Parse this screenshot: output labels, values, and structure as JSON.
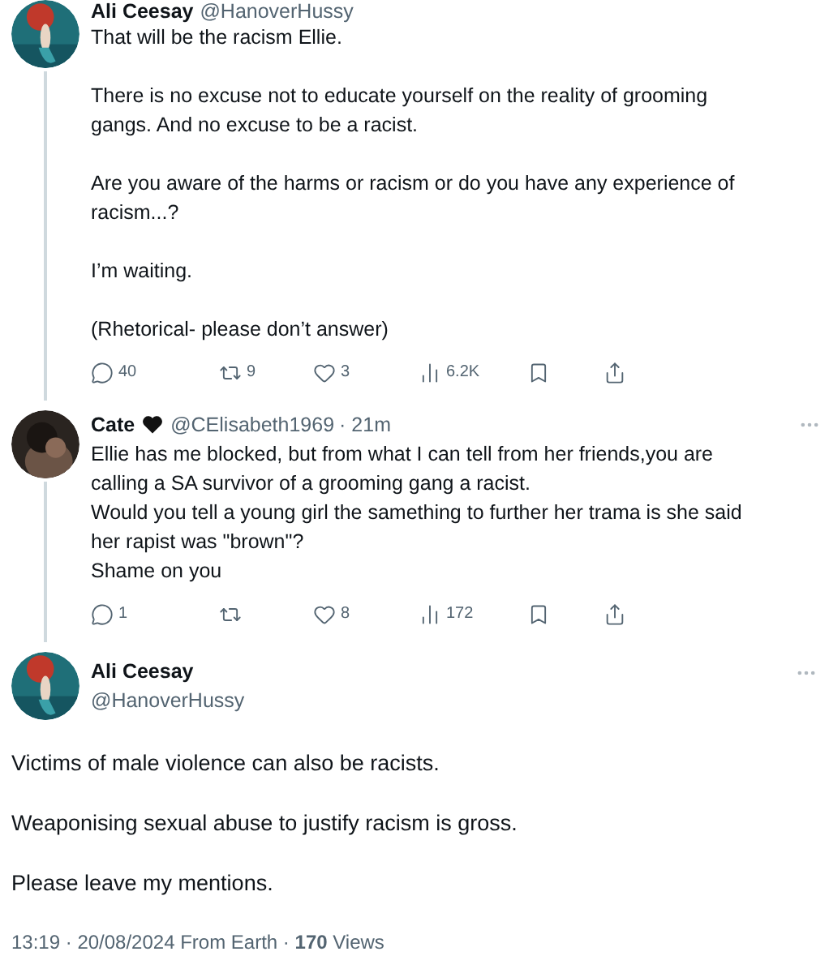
{
  "tweets": [
    {
      "author": {
        "name": "Ali Ceesay",
        "handle": "@HanoverHussy"
      },
      "more_button": false,
      "thread_line": true,
      "body": "That will be the racism Ellie.\n\nThere is no excuse not to educate yourself on the reality of grooming gangs. And no excuse to be a racist.\n\nAre you aware of the harms or racism or do you have any experience of racism...?\n\nI’m waiting.\n\n(Rhetorical- please don’t answer)",
      "actions": [
        {
          "kind": "reply",
          "count": "40"
        },
        {
          "kind": "repost",
          "count": "9"
        },
        {
          "kind": "like",
          "count": "3"
        },
        {
          "kind": "views",
          "count": "6.2K"
        },
        {
          "kind": "bookmark"
        },
        {
          "kind": "share"
        }
      ]
    },
    {
      "author": {
        "name": "Cate",
        "handle": "@CElisabeth1969",
        "time": "· 21m"
      },
      "more_button": true,
      "thread_line": true,
      "body": "Ellie has me blocked, but from what I can tell from her friends,you are calling a SA survivor of a grooming gang a racist.\nWould you tell a young girl the samething to further her trama is she said her rapist was \"brown\"?\nShame on you",
      "actions": [
        {
          "kind": "reply",
          "count": "1"
        },
        {
          "kind": "repost"
        },
        {
          "kind": "like",
          "count": "8"
        },
        {
          "kind": "views",
          "count": "172"
        },
        {
          "kind": "bookmark"
        },
        {
          "kind": "share"
        }
      ]
    }
  ],
  "main_tweet": {
    "author": {
      "name": "Ali Ceesay",
      "handle": "@HanoverHussy"
    },
    "more_button": true,
    "paragraphs": [
      "Victims of male violence can also be racists.",
      "Weaponising sexual abuse to justify racism is gross.",
      "Please leave my mentions."
    ],
    "meta": "13:19 · 20/08/2024 From Earth · **170** Views"
  }
}
